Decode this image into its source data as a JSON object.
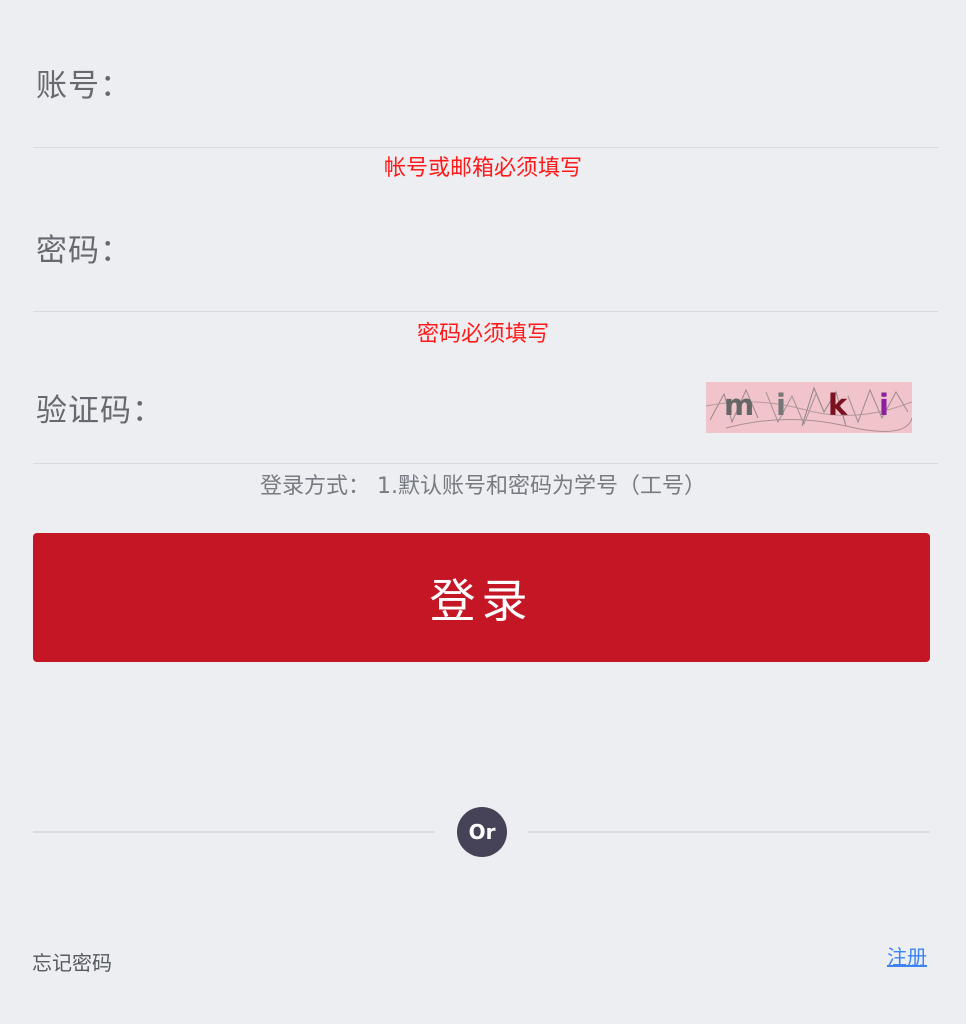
{
  "form": {
    "account": {
      "label": "账号：",
      "value": "",
      "placeholder": "",
      "error": "帐号或邮箱必须填写"
    },
    "password": {
      "label": "密码：",
      "value": "",
      "placeholder": "",
      "error": "密码必须填写"
    },
    "captcha": {
      "label": "验证码：",
      "value": "",
      "placeholder": "",
      "image_chars": [
        "m",
        "i",
        "k",
        "i"
      ],
      "image_colors": [
        "#666666",
        "#777777",
        "#7a1020",
        "#8a1fa0"
      ]
    },
    "hint": "登录方式：  1.默认账号和密码为学号（工号）",
    "login_label": "登录"
  },
  "divider": {
    "label": "Or"
  },
  "footer": {
    "forgot_label": "忘记密码",
    "register_label": "注册"
  },
  "colors": {
    "accent": "#c51625",
    "error": "#ff1a1a",
    "link": "#3d84f0",
    "or_badge": "#464258"
  }
}
